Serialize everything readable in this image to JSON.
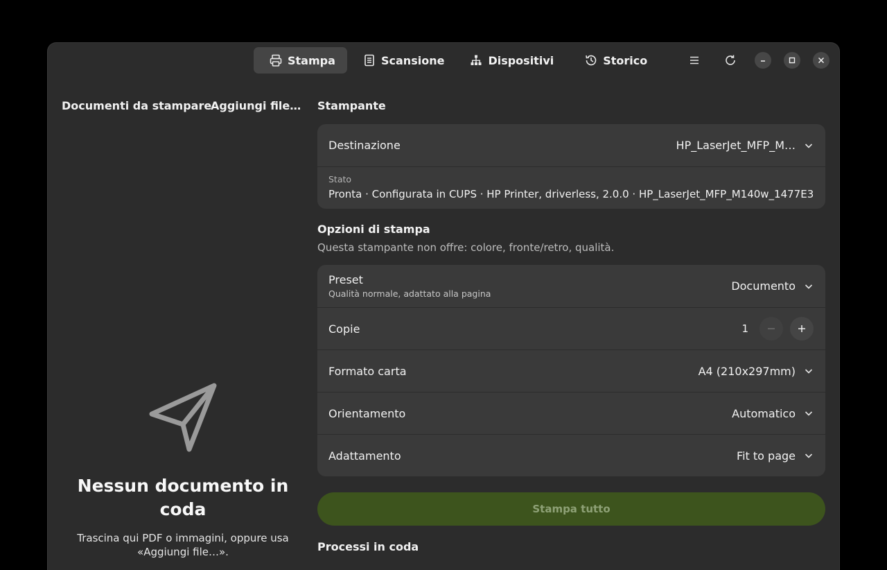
{
  "header": {
    "tabs": [
      {
        "label": "Stampa",
        "icon": "printer-icon",
        "active": true
      },
      {
        "label": "Scansione",
        "icon": "scanner-icon",
        "active": false
      },
      {
        "label": "Dispositivi",
        "icon": "devices-icon",
        "active": false
      },
      {
        "label": "Storico",
        "icon": "history-icon",
        "active": false
      }
    ]
  },
  "left": {
    "title": "Documenti da stampare",
    "add_label": "Aggiungi file…",
    "empty_title": "Nessun documento in coda",
    "empty_desc": "Trascina qui PDF o immagini, oppure usa «Aggiungi file…»."
  },
  "printer": {
    "section_title": "Stampante",
    "destination_label": "Destinazione",
    "destination_value": "HP_LaserJet_MFP_M…",
    "status_label": "Stato",
    "status_value": "Pronta · Configurata in CUPS · HP Printer, driverless, 2.0.0 · HP_LaserJet_MFP_M140w_1477E3"
  },
  "options": {
    "section_title": "Opzioni di stampa",
    "subtitle": "Questa stampante non offre: colore, fronte/retro, qualità.",
    "preset_label": "Preset",
    "preset_sub": "Qualità normale, adattato alla pagina",
    "preset_value": "Documento",
    "copies_label": "Copie",
    "copies_value": "1",
    "paper_label": "Formato carta",
    "paper_value": "A4 (210x297mm)",
    "orientation_label": "Orientamento",
    "orientation_value": "Automatico",
    "fit_label": "Adattamento",
    "fit_value": "Fit to page"
  },
  "actions": {
    "print_all": "Stampa tutto"
  },
  "queue": {
    "section_title": "Processi in coda"
  },
  "colors": {
    "accent": "#3d541d",
    "background": "#2c2c2c",
    "card": "#3a3a3a"
  }
}
